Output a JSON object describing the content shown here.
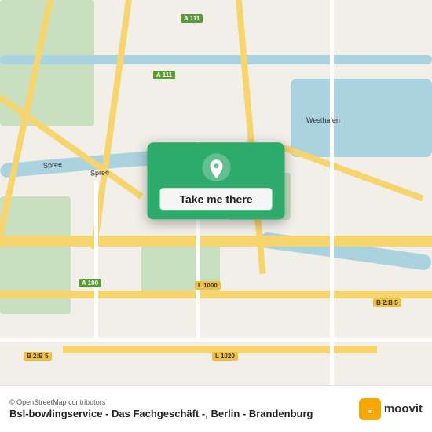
{
  "map": {
    "alt": "Map of Berlin Brandenburg area",
    "attribution": "© OpenStreetMap contributors"
  },
  "popup": {
    "button_label": "Take me there",
    "pin_icon": "map-pin"
  },
  "bottom_bar": {
    "location_name": "Bsl-bowlingservice - Das Fachgeschäft -, Berlin - Brandenburg",
    "osm_credit": "© OpenStreetMap contributors",
    "brand": "moovit"
  },
  "roads": {
    "a111": "A 111",
    "a100": "A 100",
    "l1000": "L 1000",
    "l1020": "L 1020",
    "b2b5": "B 2:B 5",
    "b2b5_right": "B 2:B 5",
    "spree": "Spree",
    "westhafen": "Westhafen"
  }
}
